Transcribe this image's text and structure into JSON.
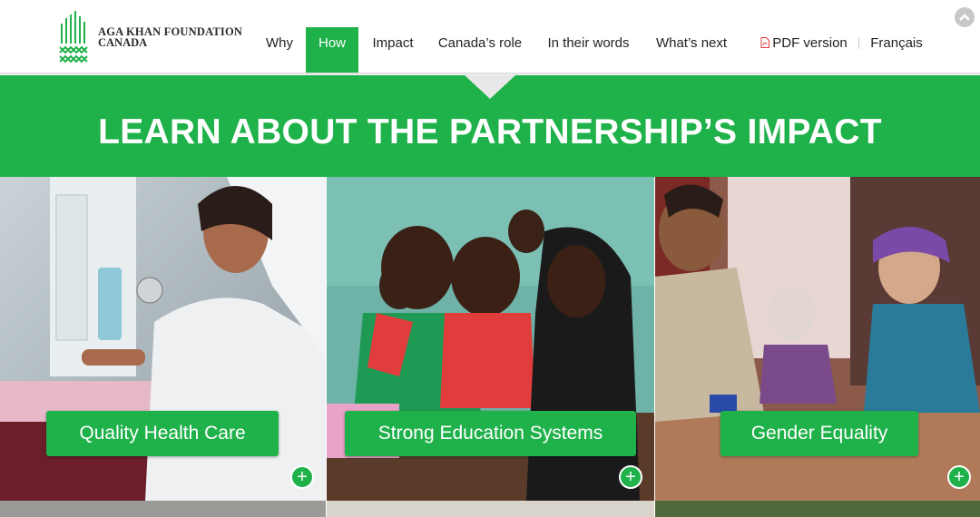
{
  "header": {
    "logo": {
      "line1": "AGA KHAN FOUNDATION",
      "line2": "CANADA",
      "icon": "akf-logo-icon"
    },
    "nav": [
      {
        "label": "Why",
        "active": false
      },
      {
        "label": "How",
        "active": true
      },
      {
        "label": "Impact",
        "active": false
      },
      {
        "label": "Canada’s role",
        "active": false
      },
      {
        "label": "In their words",
        "active": false
      },
      {
        "label": "What’s next",
        "active": false
      }
    ],
    "pdf": {
      "label": "PDF version",
      "icon": "pdf-icon"
    },
    "language": "Français",
    "scroll_top_icon": "chevron-up-icon"
  },
  "banner": {
    "title": "LEARN ABOUT THE PARTNERSHIP’S IMPACT"
  },
  "tiles": [
    {
      "label": "Quality Health Care",
      "expand_icon": "plus-icon"
    },
    {
      "label": "Strong Education Systems",
      "expand_icon": "plus-icon"
    },
    {
      "label": "Gender Equality",
      "expand_icon": "plus-icon"
    }
  ],
  "colors": {
    "accent": "#1fb14a",
    "text": "#222222"
  }
}
